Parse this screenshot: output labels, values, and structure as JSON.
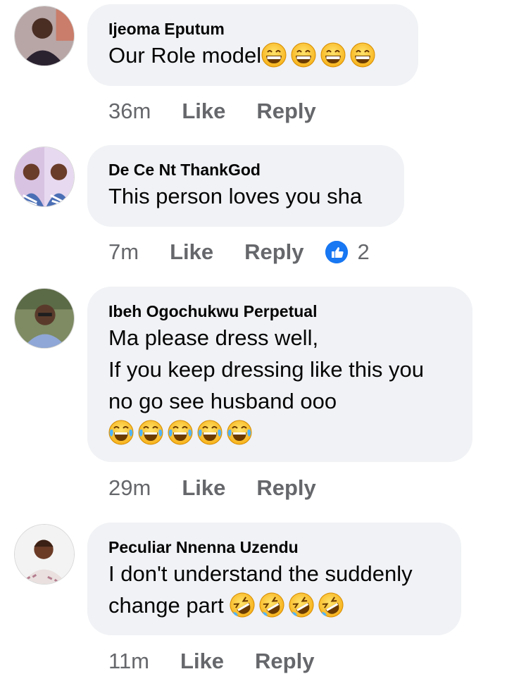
{
  "colors": {
    "bubble": "#f0f2f5",
    "meta": "#65676b",
    "like_blue": "#1877f2"
  },
  "comments": [
    {
      "author": "Ijeoma Eputum",
      "lines": [
        "Our Role model"
      ],
      "emoji": [
        "grinning-face-with-smiling-eyes",
        "grinning-face-with-smiling-eyes",
        "grinning-face-with-smiling-eyes",
        "grinning-face-with-smiling-eyes"
      ],
      "time": "36m",
      "like": "Like",
      "reply": "Reply"
    },
    {
      "author": "De Ce Nt ThankGod",
      "lines": [
        "This person loves you sha"
      ],
      "time": "7m",
      "like": "Like",
      "reply": "Reply",
      "reaction": {
        "icon": "like-reaction-icon",
        "count": "2"
      }
    },
    {
      "author": "Ibeh Ogochukwu Perpetual",
      "lines": [
        "Ma please dress well,",
        "If you keep dressing like this you",
        "no go see husband ooo"
      ],
      "emoji": [
        "face-with-tears-of-joy",
        "face-with-tears-of-joy",
        "face-with-tears-of-joy",
        "face-with-tears-of-joy",
        "face-with-tears-of-joy"
      ],
      "time": "29m",
      "like": "Like",
      "reply": "Reply"
    },
    {
      "author": "Peculiar Nnenna Uzendu",
      "lines": [
        "I don't understand the suddenly",
        "change part"
      ],
      "emoji": [
        "rolling-on-the-floor-laughing",
        "rolling-on-the-floor-laughing",
        "rolling-on-the-floor-laughing",
        "rolling-on-the-floor-laughing"
      ],
      "time": "11m",
      "like": "Like",
      "reply": "Reply"
    }
  ]
}
